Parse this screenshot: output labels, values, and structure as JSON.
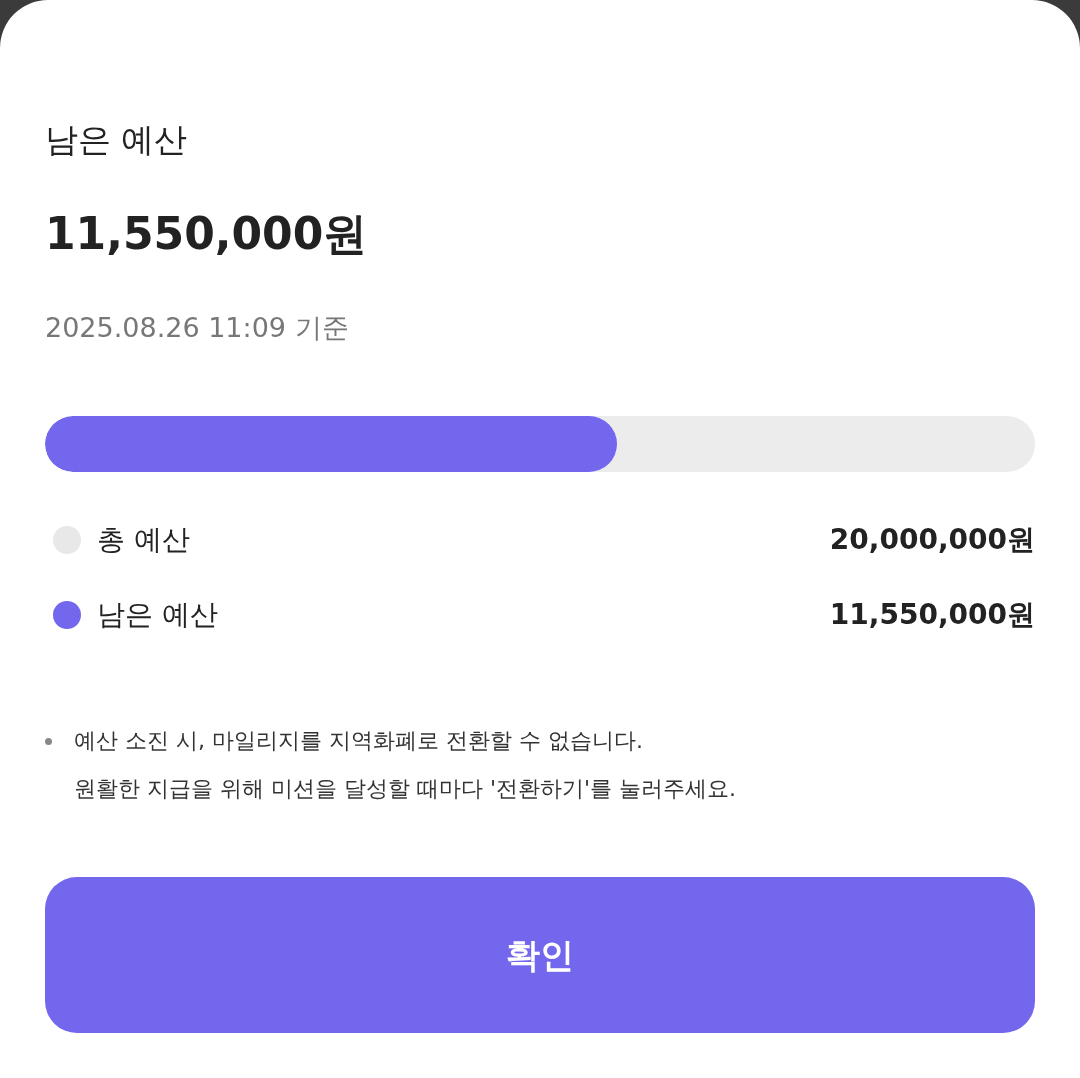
{
  "header": {
    "title": "남은 예산",
    "amount": "11,550,000원",
    "as_of": "2025.08.26 11:09 기준"
  },
  "progress": {
    "level": 0.5775
  },
  "legend": [
    {
      "label": "총 예산",
      "value": "20,000,000원",
      "color": "#e8e8e8"
    },
    {
      "label": "남은 예산",
      "value": "11,550,000원",
      "color": "#7367ee"
    }
  ],
  "notes": [
    {
      "text": "예산 소진 시, 마일리지를 지역화폐로 전환할 수 없습니다.",
      "bullet": true
    },
    {
      "text": "원활한 지급을 위해 미션을 달성할 때마다 '전환하기'를 눌러주세요.",
      "bullet": false
    }
  ],
  "confirm_button": "확인"
}
